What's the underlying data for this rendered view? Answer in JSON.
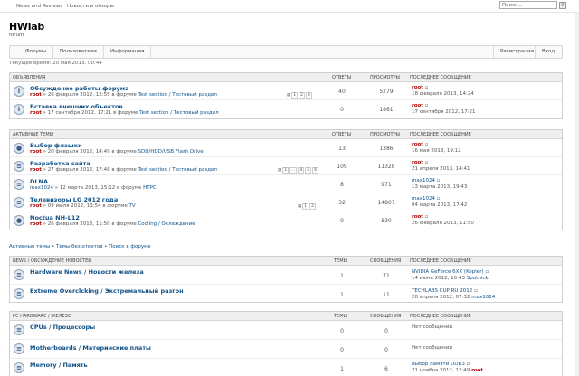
{
  "top": {
    "link1": "News and Reviews",
    "link2": "Новости и обзоры",
    "search_placeholder": "Поиск..."
  },
  "site": {
    "title": "HWlab",
    "subtitle": "forum"
  },
  "nav": {
    "forums": "Форумы",
    "users": "Пользователи",
    "info": "Информация",
    "register": "Регистрация",
    "login": "Вход"
  },
  "time": "Текущее время: 20 мая 2013, 00:44",
  "announce": {
    "header": "Объявления",
    "cols": {
      "replies": "Ответы",
      "views": "Просмотры",
      "last": "Последнее сообщение"
    },
    "rows": [
      {
        "title": "Обсуждение работы форума",
        "author": "root",
        "date": "» 26 февраля 2012, 12:55 в форуме ",
        "forum": "Test section / Тестовый раздел",
        "replies": "40",
        "views": "5279",
        "last_user": "root",
        "last_date": "18 февраля 2013, 14:24",
        "pages": [
          "1",
          "2",
          "3"
        ]
      },
      {
        "title": "Вставка внешних объектов",
        "author": "root",
        "date": "» 17 сентября 2012, 17:21 в форуме ",
        "forum": "Test section / Тестовый раздел",
        "replies": "0",
        "views": "1861",
        "last_user": "root",
        "last_date": "17 сентября 2012, 17:21"
      }
    ]
  },
  "active": {
    "header": "Активные темы",
    "cols": {
      "replies": "Ответы",
      "views": "Просмотры",
      "last": "Последнее сообщение"
    },
    "rows": [
      {
        "title": "Выбор флэшки",
        "author": "root",
        "date": "» 20 февраля 2012, 14:49 в форуме ",
        "forum": "SDD/HDD/USB Flash Drive",
        "replies": "13",
        "views": "1386",
        "last_user": "root",
        "last_date": "16 мая 2013, 19:12"
      },
      {
        "title": "Разработка сайта",
        "author": "root",
        "date": "» 27 февраля 2012, 17:48 в форуме ",
        "forum": "Test section / Тестовый раздел",
        "replies": "109",
        "views": "11328",
        "last_user": "root",
        "last_date": "21 апреля 2013, 14:41",
        "pages": [
          "1",
          "...",
          "4",
          "5",
          "6"
        ]
      },
      {
        "title": "DLNA",
        "author": "max1024",
        "date": "» 12 марта 2013, 15:12 в форуме ",
        "forum": "HTPC",
        "replies": "8",
        "views": "971",
        "last_user": "max1024",
        "last_date": "13 марта 2013, 19:43"
      },
      {
        "title": "Телевизоры LG 2012 года",
        "author": "root",
        "date": "» 09 июля 2012, 13:54 в форуме ",
        "forum": "TV",
        "replies": "32",
        "views": "14807",
        "last_user": "max1024",
        "last_date": "04 марта 2013, 17:42",
        "pages": [
          "1",
          "2"
        ]
      },
      {
        "title": "Noctua NH-L12",
        "author": "root",
        "date": "» 26 февраля 2013, 11:50 в форуме ",
        "forum": "Cooling / Охлаждение",
        "replies": "0",
        "views": "830",
        "last_user": "root",
        "last_date": "26 февраля 2013, 11:50"
      }
    ]
  },
  "breadcrumb": "Активные темы • Темы без ответов • Поиск в форуме",
  "news": {
    "header": "News / обсуждение новостей",
    "cols": {
      "topics": "Темы",
      "posts": "Сообщения",
      "last": "Последнее сообщение"
    },
    "rows": [
      {
        "title": "Hardware News / Новости железа",
        "topics": "1",
        "posts": "71",
        "last_title": "NVIDIA GeForce 6XX (Kepler)",
        "last_date": "14 июня 2012, 10:43 ",
        "last_user": "Sputnick"
      },
      {
        "title": "Extreme Overclcking / Экстремальный разгон",
        "topics": "1",
        "posts": "11",
        "last_title": "TECHLABS CUP RU 2012",
        "last_date": "20 апреля 2012, 07:32 ",
        "last_user": "max1024"
      }
    ]
  },
  "hw": {
    "header": "PC Hardware / Железо",
    "cols": {
      "topics": "Темы",
      "posts": "Сообщения",
      "last": "Последнее сообщение"
    },
    "rows": [
      {
        "title": "CPUs / Процессоры",
        "topics": "0",
        "posts": "0",
        "last_title": "Нет сообщений",
        "last_date": "",
        "last_user": ""
      },
      {
        "title": "Motherboards / Материнские платы",
        "topics": "0",
        "posts": "0",
        "last_title": "Нет сообщений",
        "last_date": "",
        "last_user": ""
      },
      {
        "title": "Memory / Память",
        "topics": "1",
        "posts": "6",
        "last_title": "Выбор памяти DDR3",
        "last_date": "21 ноября 2012, 12:49 ",
        "last_user": "root"
      }
    ]
  }
}
